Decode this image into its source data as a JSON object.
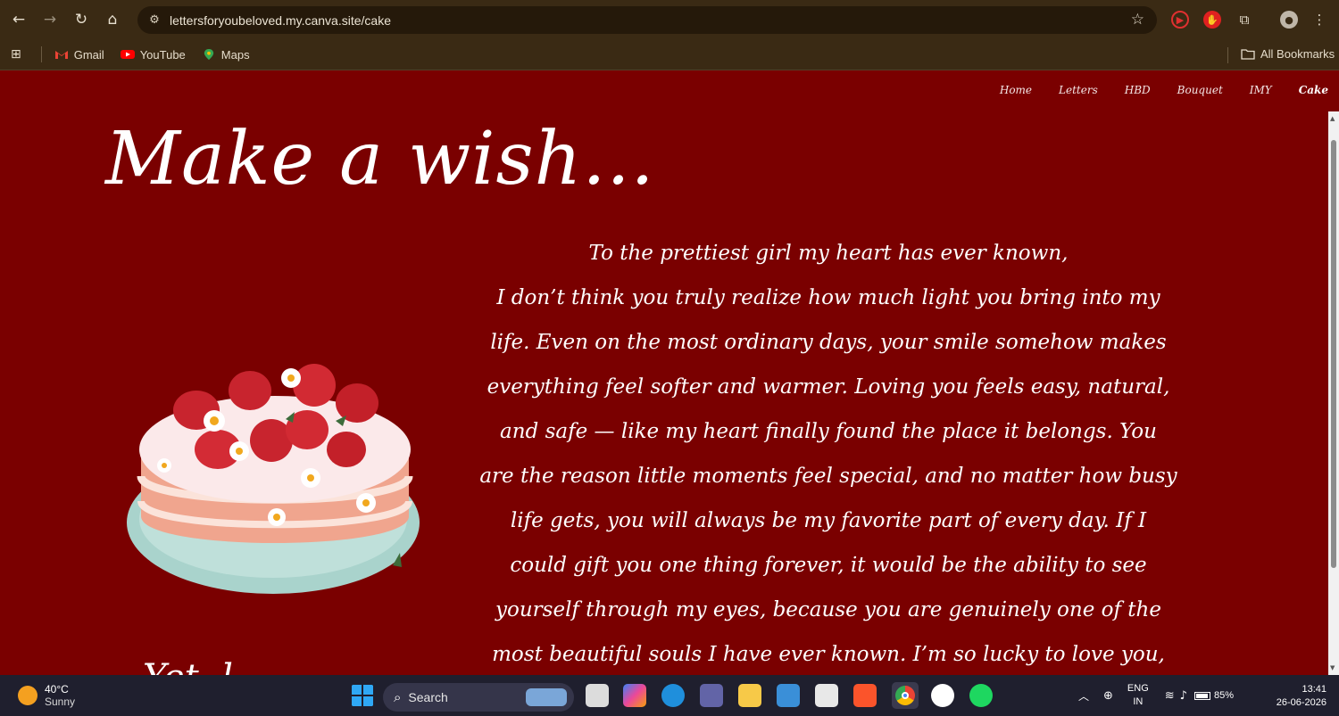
{
  "browser": {
    "url": "lettersforyoubeloved.my.canva.site/cake",
    "bookmarks": [
      {
        "label": "Gmail",
        "icon": "gmail-icon"
      },
      {
        "label": "YouTube",
        "icon": "youtube-icon"
      },
      {
        "label": "Maps",
        "icon": "maps-icon"
      }
    ],
    "all_bookmarks_label": "All Bookmarks"
  },
  "site": {
    "nav": [
      "Home",
      "Letters",
      "HBD",
      "Bouquet",
      "IMY",
      "Cake"
    ],
    "active_nav": "Cake",
    "headline": "Make a wish...",
    "letter_lines": [
      "To the prettiest girl my heart has ever known,",
      "I don’t think you truly realize how much light you bring into my",
      "life. Even on the most ordinary days, your smile somehow makes",
      "everything feel softer and warmer. Loving you feels easy, natural,",
      "and safe — like my heart finally found the place it belongs. You",
      "are the reason little moments feel special, and no matter how busy",
      "life gets, you will always be my favorite part of every day. If I",
      "could gift you one thing forever, it would be the ability to see",
      "yourself through my eyes, because you are genuinely one of the",
      "most beautiful souls I have ever known. I’m so lucky to love you,"
    ],
    "signature_partial": "Yet..l"
  },
  "taskbar": {
    "weather_temp": "40°C",
    "weather_desc": "Sunny",
    "search_label": "Search",
    "lang_top": "ENG",
    "lang_bottom": "IN",
    "battery": "85%",
    "time": "13:41",
    "date": "26-06-2026"
  },
  "colors": {
    "page_bg": "#7a0000",
    "chrome_bg": "#3a2a14",
    "text": "#ffffff"
  }
}
